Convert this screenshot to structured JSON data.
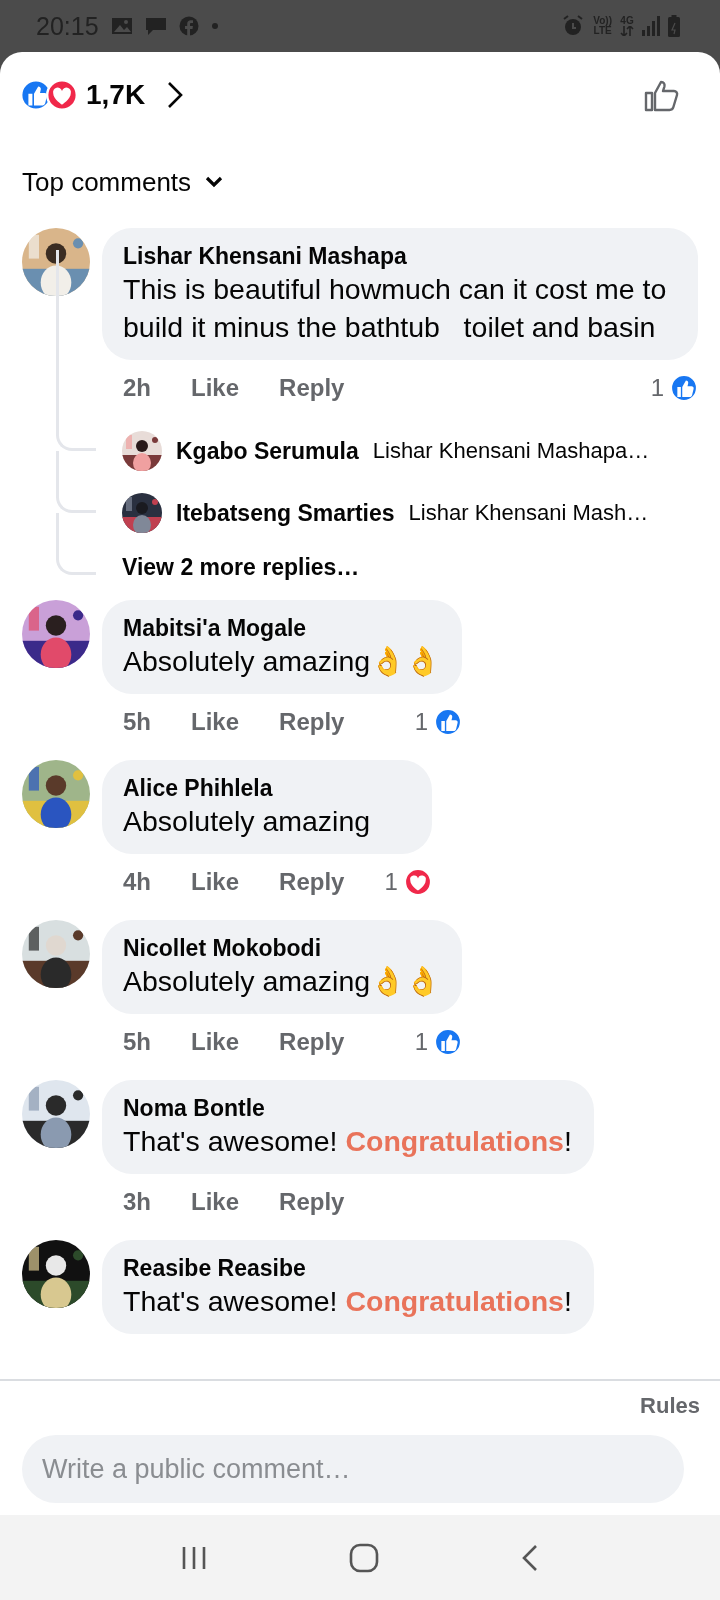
{
  "status_bar": {
    "time": "20:15",
    "volte": "Vo))",
    "lte": "LTE",
    "network": "4G"
  },
  "header": {
    "reactions": [
      {
        "kind": "like"
      },
      {
        "kind": "love"
      }
    ],
    "count": "1,7K"
  },
  "sort": {
    "label": "Top comments"
  },
  "comments": [
    {
      "name": "Lishar Khensani Mashapa",
      "body": [
        {
          "kind": "plain",
          "text": "This is beautiful howmuch can it cost me to build it minus the bathtub   toilet and basin"
        }
      ],
      "time": "2h",
      "like": "Like",
      "reply": "Reply",
      "reaction": {
        "count": "1",
        "kind": "like"
      },
      "replies": [
        {
          "name": "Kgabo Serumula",
          "text": "Lishar Khensani Mashapa…"
        },
        {
          "name": "Itebatseng Smarties",
          "text": "Lishar Khensani Mash…"
        }
      ],
      "more": "View 2 more replies…"
    },
    {
      "name": "Mabitsi'a Mogale",
      "body": [
        {
          "kind": "plain",
          "text": "Absolutely amazing👌👌"
        }
      ],
      "time": "5h",
      "like": "Like",
      "reply": "Reply",
      "reaction": {
        "count": "1",
        "kind": "like"
      }
    },
    {
      "name": "Alice Phihlela",
      "body": [
        {
          "kind": "plain",
          "text": "Absolutely amazing"
        }
      ],
      "time": "4h",
      "like": "Like",
      "reply": "Reply",
      "reaction": {
        "count": "1",
        "kind": "love"
      }
    },
    {
      "name": "Nicollet Mokobodi",
      "body": [
        {
          "kind": "plain",
          "text": "Absolutely amazing👌👌"
        }
      ],
      "time": "5h",
      "like": "Like",
      "reply": "Reply",
      "reaction": {
        "count": "1",
        "kind": "like"
      }
    },
    {
      "name": "Noma Bontle",
      "body": [
        {
          "kind": "plain",
          "text": "That's awesome! "
        },
        {
          "kind": "highlight",
          "text": "Congratulations"
        },
        {
          "kind": "plain",
          "text": "!"
        }
      ],
      "time": "3h",
      "like": "Like",
      "reply": "Reply"
    },
    {
      "name": "Reasibe Reasibe",
      "body": [
        {
          "kind": "plain",
          "text": "That's awesome! "
        },
        {
          "kind": "highlight",
          "text": "Congratulations"
        },
        {
          "kind": "plain",
          "text": "!"
        }
      ]
    }
  ],
  "footer": {
    "rules": "Rules",
    "placeholder": "Write a public comment…"
  }
}
